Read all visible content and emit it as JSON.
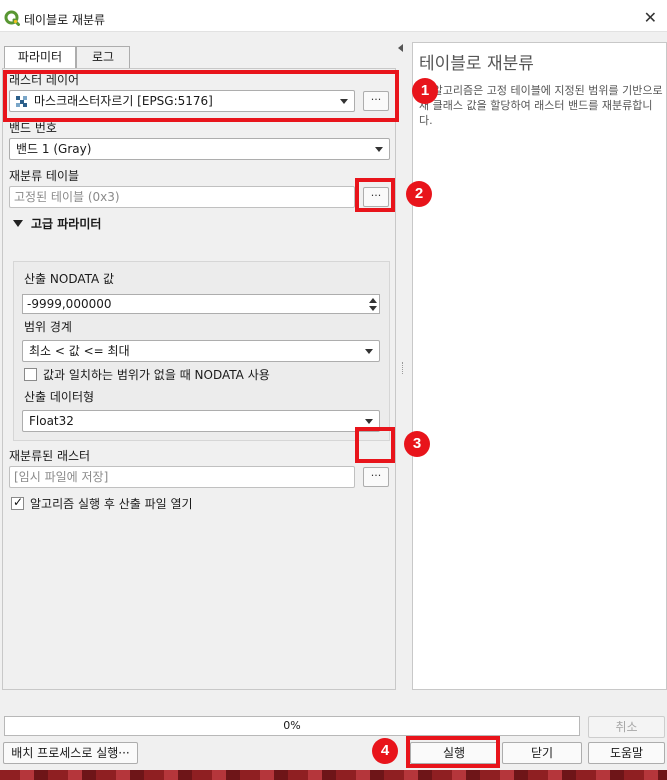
{
  "window": {
    "title": "테이블로 재분류",
    "close": "✕"
  },
  "tabs": [
    {
      "label": "파라미터"
    },
    {
      "label": "로그"
    }
  ],
  "params": {
    "raster_layer": {
      "label": "래스터 레이어",
      "value": "마스크래스터자르기 [EPSG:5176]",
      "browse": "···"
    },
    "band": {
      "label": "밴드 번호",
      "value": "밴드 1 (Gray)"
    },
    "reclass_table": {
      "label": "재분류 테이블",
      "value": "고정된 테이블 (0x3)",
      "browse": "···"
    },
    "advanced": {
      "header": "고급 파라미터",
      "nodata": {
        "label": "산출 NODATA 값",
        "value": "-9999,000000"
      },
      "range": {
        "label": "범위 경계",
        "value": "최소 < 값 <= 최대"
      },
      "nodata_check": {
        "label": "값과 일치하는 범위가 없을 때 NODATA 사용",
        "checked": false
      },
      "dtype": {
        "label": "산출 데이터형",
        "value": "Float32"
      }
    },
    "output": {
      "label": "재분류된 래스터",
      "placeholder": "[임시 파일에 저장]",
      "browse": "···"
    },
    "open_output": {
      "label": "알고리즘 실행 후 산출 파일 열기",
      "checked": true
    }
  },
  "help": {
    "title": "테이블로 재분류",
    "body": "이 알고리즘은 고정 테이블에 지정된 범위를 기반으로 새 클래스 값을 할당하여 래스터 밴드를 재분류합니다."
  },
  "progress": {
    "value": 0,
    "text": "0%"
  },
  "buttons": {
    "cancel": "취소",
    "batch": "배치 프로세스로 실행···",
    "run": "실행",
    "close": "닫기",
    "help": "도움말"
  },
  "annotations": {
    "badge1": "1",
    "badge2": "2",
    "badge3": "3",
    "badge4": "4"
  },
  "colors": {
    "annotation_red": "#e8141b",
    "qgis_green": "#589632",
    "progress_green": "#4caf50"
  }
}
